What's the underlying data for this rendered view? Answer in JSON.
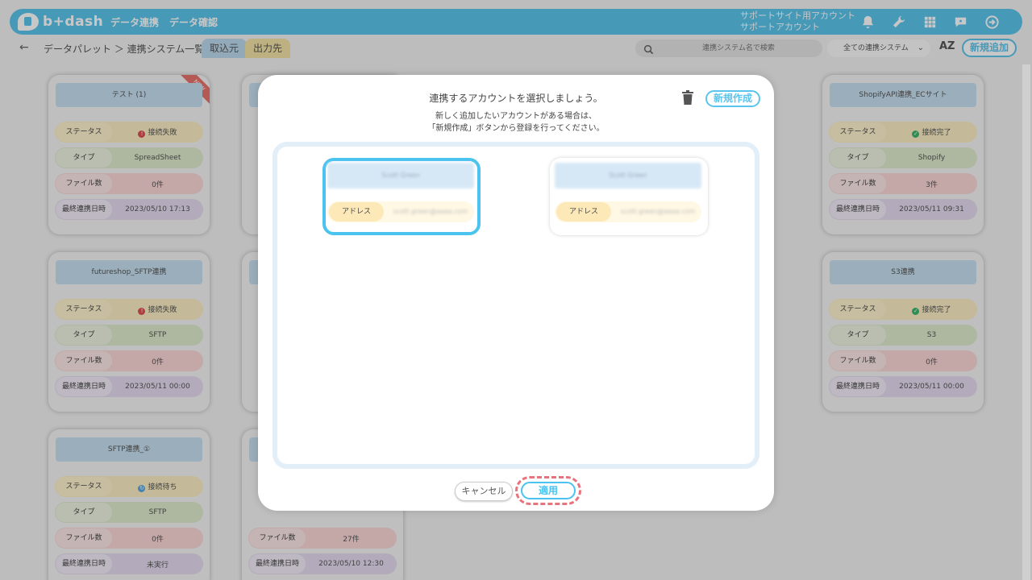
{
  "header": {
    "logo": "b+dash",
    "nav": [
      "データ連携",
      "データ確認"
    ],
    "account_line1": "サポートサイト用アカウント",
    "account_line2": "サポートアカウント"
  },
  "subbar": {
    "back": "←",
    "breadcrumb": "データパレット ＞ 連携システム一覧",
    "tab_import": "取込元",
    "tab_export": "出力先",
    "search_placeholder": "連携システム名で検索",
    "filter_selected": "全ての連携システム",
    "sort_label": "AZ",
    "add_button": "新規追加"
  },
  "labels": {
    "status": "ステータス",
    "type": "タイプ",
    "files": "ファイル数",
    "last_sync": "最終連携日時"
  },
  "cards": [
    {
      "title": "テスト (1)",
      "status": "接続失敗",
      "status_kind": "fail",
      "type": "SpreadSheet",
      "files": "0件",
      "last_sync": "2023/05/10 17:13",
      "badge": "NEW"
    },
    {
      "title": "",
      "status": "",
      "status_kind": "",
      "type": "",
      "files": "",
      "last_sync": ""
    },
    {
      "title": "ShopifyAPI連携_ECサイト",
      "status": "接続完了",
      "status_kind": "ok",
      "type": "Shopify",
      "files": "3件",
      "last_sync": "2023/05/11 09:31"
    },
    {
      "title": "futureshop_SFTP連携",
      "status": "接続失敗",
      "status_kind": "fail",
      "type": "SFTP",
      "files": "0件",
      "last_sync": "2023/05/11 00:00"
    },
    {
      "title": "",
      "status": "",
      "status_kind": "",
      "type": "",
      "files": "",
      "last_sync": ""
    },
    {
      "title": "S3連携",
      "status": "接続完了",
      "status_kind": "ok",
      "type": "S3",
      "files": "0件",
      "last_sync": "2023/05/11 00:00"
    },
    {
      "title": "SFTP連携_①",
      "status": "接続待ち",
      "status_kind": "wait",
      "type": "SFTP",
      "files": "0件",
      "last_sync": "未実行"
    },
    {
      "title": "",
      "status": "",
      "status_kind": "",
      "type": "",
      "files": "27件",
      "last_sync": "2023/05/10 12:30"
    }
  ],
  "modal": {
    "title": "連携するアカウントを選択しましょう。",
    "subtitle1": "新しく追加したいアカウントがある場合は、",
    "subtitle2": "「新規作成」ボタンから登録を行ってください。",
    "new_button": "新規作成",
    "accounts": [
      {
        "name": "Scott Green",
        "address_label": "アドレス",
        "address": "scott.green@aaaa.com",
        "selected": true
      },
      {
        "name": "Scott Green",
        "address_label": "アドレス",
        "address": "scott.green@aaaa.com",
        "selected": false
      }
    ],
    "cancel": "キャンセル",
    "apply": "適用"
  },
  "colors": {
    "accent": "#5bc4ec",
    "highlight": "#e7737c"
  }
}
